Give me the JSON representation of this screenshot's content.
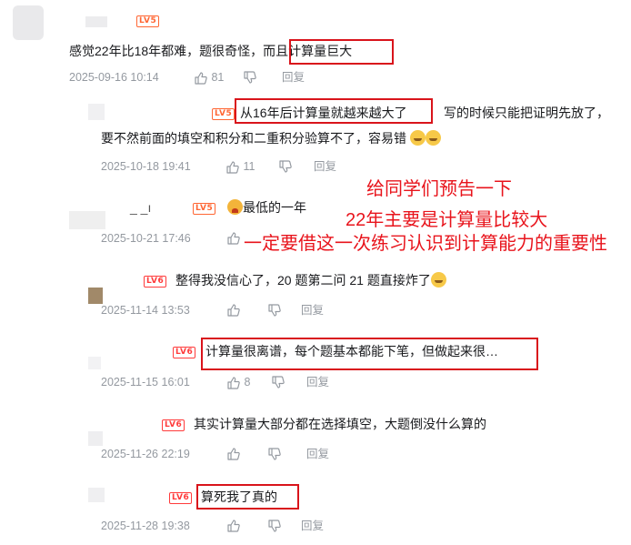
{
  "comments": [
    {
      "level": "LV5",
      "text_before": "感觉22年比18年都难，题很奇怪，",
      "text_highlight": "而且计算量巨大",
      "date": "2025-09-16 10:14",
      "likes": "81",
      "reply": "回复"
    },
    {
      "level": "LV5",
      "text_highlight": "从16年后计算量就越来越大了",
      "text_after": "写的时候只能把证明先放了，",
      "text_line2": "要不然前面的填空和积分和二重积分验算不了，容易错",
      "date": "2025-10-18 19:41",
      "likes": "11",
      "reply": "回复"
    },
    {
      "name_fragment": "_  _ı",
      "level": "LV5",
      "text": "最低的一年",
      "date": "2025-10-21 17:46",
      "reply": "回复"
    },
    {
      "level": "LV6",
      "text": "整得我没信心了，20 题第二问 21 题直接炸了",
      "date": "2025-11-14 13:53",
      "reply": "回复"
    },
    {
      "level": "LV6",
      "text_highlight": "计算量很离谱，每个题基本都能下笔，但做起来很…",
      "date": "2025-11-15 16:01",
      "likes": "8",
      "reply": "回复"
    },
    {
      "level": "LV6",
      "text": "其实计算量大部分都在选择填空，大题倒没什么算的",
      "date": "2025-11-26 22:19",
      "reply": "回复"
    },
    {
      "level": "LV6",
      "text_highlight": "算死我了真的",
      "date": "2025-11-28 19:38",
      "reply": "回复"
    }
  ],
  "annotation": {
    "line1": "给同学们预告一下",
    "line2": "22年主要是计算量比较大",
    "line3": "一定要借这一次练习认识到计算能力的重要性"
  },
  "icons": {
    "like": "thumbs-up-icon",
    "dislike": "thumbs-down-icon",
    "emoji_laugh": "laughing-emoji-icon",
    "emoji_cry": "crying-emoji-icon"
  },
  "colors": {
    "highlight_box": "#d9141b",
    "annotation_text": "#e8141c",
    "meta_text": "#9499a0",
    "level_badge": "#ff6633"
  }
}
